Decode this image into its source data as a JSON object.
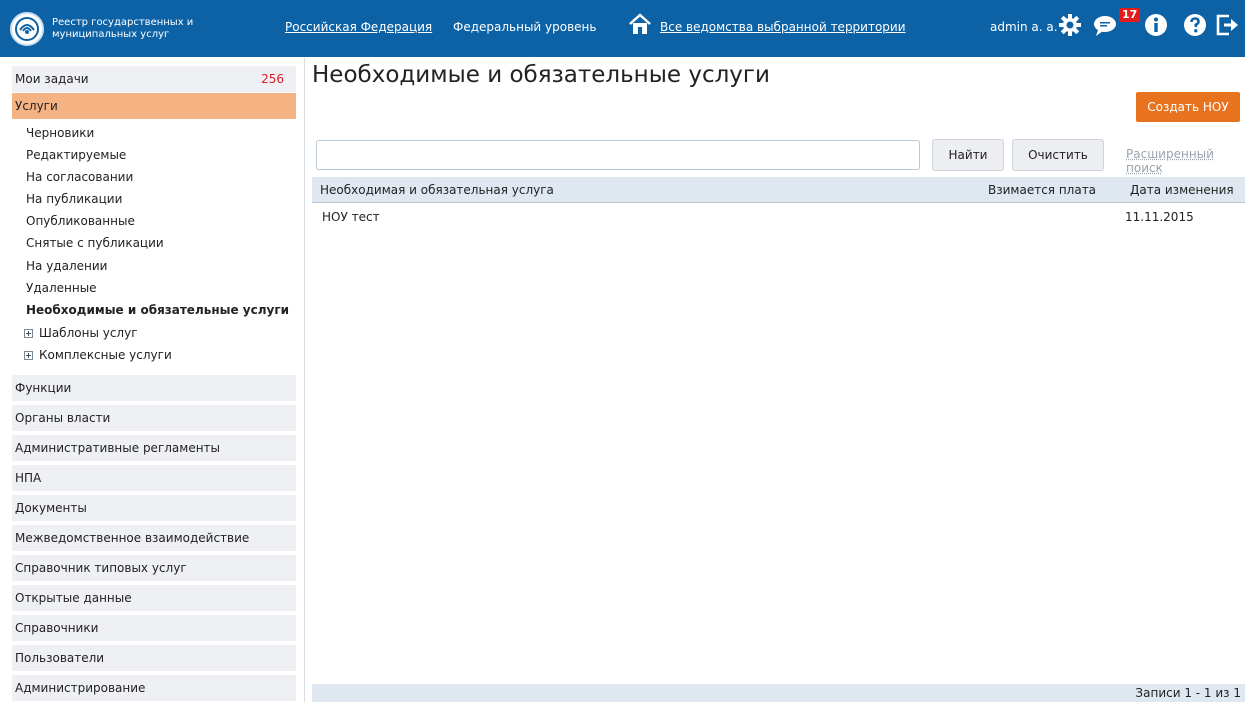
{
  "header": {
    "logo_text": "Реестр государственных и муниципальных услуг",
    "region": "Российская Федерация",
    "level": "Федеральный уровень",
    "departments": "Все ведомства выбранной территории",
    "user": "admin a. a.",
    "notifications_count": "17",
    "icons": [
      "gear-icon",
      "chat-icon",
      "info-icon",
      "help-icon",
      "logout-icon",
      "home-icon"
    ]
  },
  "sidebar": {
    "my_tasks": {
      "label": "Мои задачи",
      "count": "256"
    },
    "services": "Услуги",
    "sub_items": [
      "Черновики",
      "Редактируемые",
      "На согласовании",
      "На публикации",
      "Опубликованные",
      "Снятые с публикации",
      "На удалении",
      "Удаленные",
      "Необходимые и обязательные услуги"
    ],
    "tree_items": [
      "Шаблоны услуг",
      "Комплексные услуги"
    ],
    "sections": [
      "Функции",
      "Органы власти",
      "Административные регламенты",
      "НПА",
      "Документы",
      "Межведомственное взаимодействие",
      "Справочник типовых услуг",
      "Открытые данные",
      "Справочники",
      "Пользователи",
      "Администрирование"
    ]
  },
  "main": {
    "title": "Необходимые и обязательные услуги",
    "create_button": "Создать НОУ",
    "search": {
      "value": "",
      "placeholder": ""
    },
    "find_button": "Найти",
    "clear_button": "Очистить",
    "advanced_search": "Расширенный поиск",
    "table": {
      "columns": [
        "Необходимая и обязательная услуга",
        "Взимается плата",
        "Дата изменения"
      ],
      "rows": [
        {
          "name": "НОУ тест",
          "paid": "",
          "date": "11.11.2015"
        }
      ]
    },
    "footer": "Записи 1 - 1 из 1"
  },
  "colors": {
    "header_bg": "#0d62a6",
    "accent": "#e8731f",
    "active_item": "#f5b383",
    "count_red": "#d4202a"
  }
}
